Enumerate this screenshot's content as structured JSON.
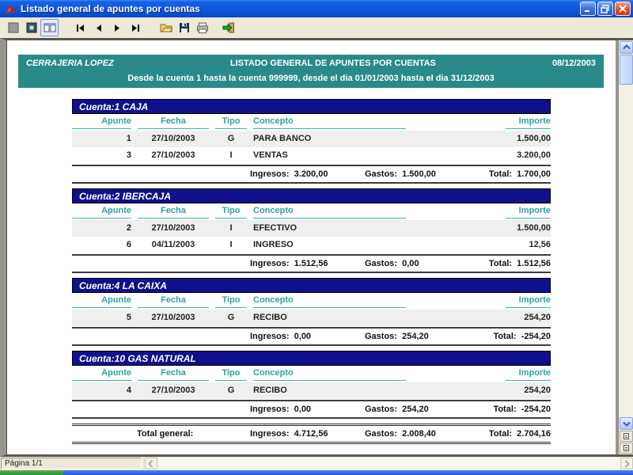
{
  "window": {
    "title": "Listado general de apuntes por cuentas"
  },
  "toolbar": {
    "buttons": [
      {
        "name": "whole-page-view",
        "icon": "whole-page-icon"
      },
      {
        "name": "page-width-view",
        "icon": "page-width-icon"
      },
      {
        "name": "two-pages-view",
        "icon": "two-pages-icon",
        "pressed": true
      },
      {
        "name": "first-page",
        "icon": "first-page-icon"
      },
      {
        "name": "previous-page",
        "icon": "previous-page-icon"
      },
      {
        "name": "next-page",
        "icon": "next-page-icon"
      },
      {
        "name": "last-page",
        "icon": "last-page-icon"
      },
      {
        "name": "open",
        "icon": "open-folder-icon"
      },
      {
        "name": "save",
        "icon": "save-icon"
      },
      {
        "name": "print",
        "icon": "printer-icon"
      },
      {
        "name": "exit",
        "icon": "exit-icon"
      }
    ]
  },
  "report": {
    "company": "CERRAJERIA LOPEZ",
    "title": "LISTADO GENERAL DE APUNTES POR CUENTAS",
    "date": "08/12/2003",
    "subtitle": "Desde la cuenta 1 hasta la cuenta 999999, desde el dia 01/01/2003 hasta el dia 31/12/2003",
    "columns": [
      "Apunte",
      "Fecha",
      "Tipo",
      "Concepto",
      "Importe"
    ],
    "labels": {
      "ingresos": "Ingresos:",
      "gastos": "Gastos:",
      "total": "Total:",
      "total_general": "Total general:"
    },
    "sections": [
      {
        "account": "Cuenta:1 CAJA",
        "rows": [
          [
            "1",
            "27/10/2003",
            "G",
            "PARA BANCO",
            "1.500,00"
          ],
          [
            "3",
            "27/10/2003",
            "I",
            "VENTAS",
            "3.200,00"
          ]
        ],
        "ingresos": "3.200,00",
        "gastos": "1.500,00",
        "total": "1.700,00"
      },
      {
        "account": "Cuenta:2 IBERCAJA",
        "rows": [
          [
            "2",
            "27/10/2003",
            "I",
            "EFECTIVO",
            "1.500,00"
          ],
          [
            "6",
            "04/11/2003",
            "I",
            "INGRESO",
            "12,56"
          ]
        ],
        "ingresos": "1.512,56",
        "gastos": "0,00",
        "total": "1.512,56"
      },
      {
        "account": "Cuenta:4 LA CAIXA",
        "rows": [
          [
            "5",
            "27/10/2003",
            "G",
            "RECIBO",
            "254,20"
          ]
        ],
        "ingresos": "0,00",
        "gastos": "254,20",
        "total": "-254,20"
      },
      {
        "account": "Cuenta:10 GAS NATURAL",
        "rows": [
          [
            "4",
            "27/10/2003",
            "G",
            "RECIBO",
            "254,20"
          ]
        ],
        "ingresos": "0,00",
        "gastos": "254,20",
        "total": "-254,20"
      }
    ],
    "grand_total": {
      "ingresos": "4.712,56",
      "gastos": "2.008,40",
      "total": "2.704,16"
    }
  },
  "status_bar": {
    "page": "Página 1/1"
  },
  "colors": {
    "header_band": "#2A8A8A",
    "account_band": "#10108C",
    "column_header_text": "#2FA3A3",
    "row_alt": "#EFEFEF",
    "titlebar_blue": "#1158DE",
    "close_red": "#E35026",
    "taskbar_green": "#2E8F2E",
    "taskbar_blue": "#2258CF"
  }
}
